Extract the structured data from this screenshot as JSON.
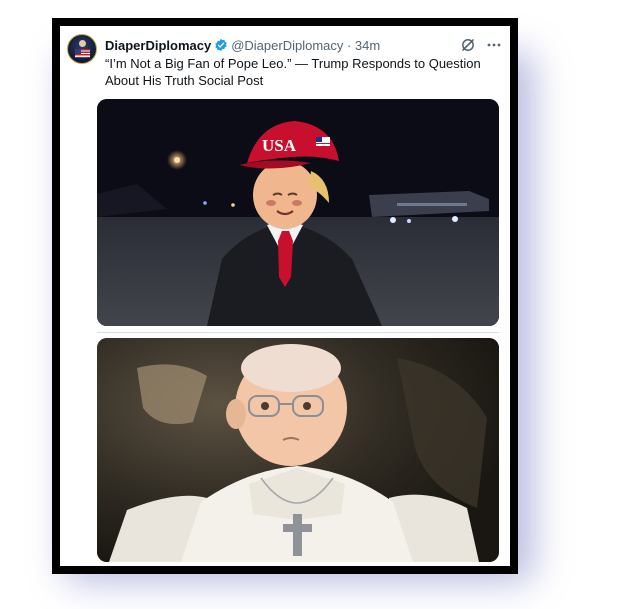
{
  "tweet": {
    "display_name": "DiaperDiplomacy",
    "handle_time": "@DiaperDiplomacy · 34m",
    "text": "“I’m Not a Big Fan of Pope Leo.” — Trump Responds to Question About His Truth Social Post"
  },
  "media": {
    "top_cap_text": "USA"
  },
  "icons": {
    "verified": "verified-badge-icon",
    "grok": "grok-icon",
    "more": "more-options-icon"
  },
  "colors": {
    "verified_blue": "#1d9bf0",
    "text_primary": "#0f1419",
    "text_secondary": "#536471",
    "frame_glow": "#4650af"
  }
}
